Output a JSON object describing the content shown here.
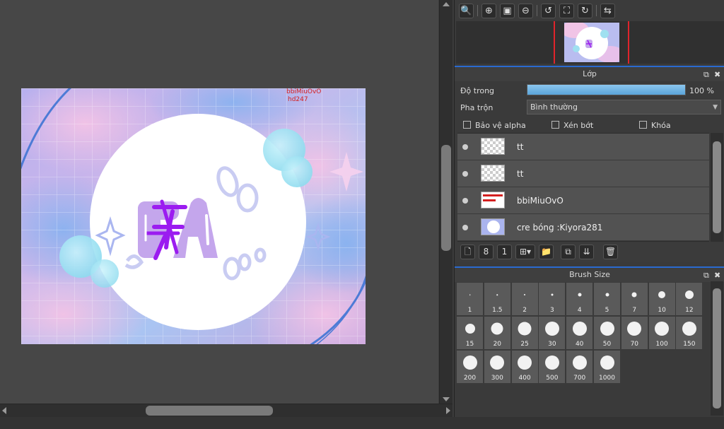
{
  "canvas": {
    "artwork_text_1": "bbiMiuOvO",
    "artwork_text_2": "hd247",
    "artwork_logo": "FA"
  },
  "navigator_toolbar": {
    "buttons": [
      {
        "icon": "magnifier-icon",
        "glyph": "🔍"
      },
      {
        "icon": "zoom-in-icon",
        "glyph": "⊕"
      },
      {
        "icon": "fit-window-icon",
        "glyph": "▣"
      },
      {
        "icon": "zoom-out-icon",
        "glyph": "⊖"
      },
      {
        "icon": "rotate-left-icon",
        "glyph": "↺"
      },
      {
        "icon": "reset-view-icon",
        "glyph": "⛶"
      },
      {
        "icon": "rotate-right-icon",
        "glyph": "↻"
      },
      {
        "icon": "flip-horizontal-icon",
        "glyph": "⇆"
      }
    ]
  },
  "layer_panel": {
    "title": "Lớp",
    "opacity_label": "Độ trong",
    "opacity_value": "100 %",
    "opacity_fraction": 1.0,
    "blend_label": "Pha trộn",
    "blend_value": "Bình thường",
    "checkboxes": [
      {
        "label": "Bảo vệ alpha",
        "checked": false
      },
      {
        "label": "Xén bớt",
        "checked": false
      },
      {
        "label": "Khóa",
        "checked": false
      }
    ],
    "layers": [
      {
        "name": "tt"
      },
      {
        "name": "tt"
      },
      {
        "name": "bbiMiuOvO"
      },
      {
        "name": "cre bóng :Kiyora281"
      }
    ],
    "tools": [
      {
        "icon": "new-layer-icon",
        "glyph": "🗋"
      },
      {
        "icon": "new-layer-8bit-icon",
        "glyph": "8"
      },
      {
        "icon": "new-layer-1bit-icon",
        "glyph": "1"
      },
      {
        "icon": "add-layer-menu-icon",
        "glyph": "⊞▾"
      },
      {
        "icon": "folder-icon",
        "glyph": "📁"
      },
      {
        "icon": "duplicate-layer-icon",
        "glyph": "⧉"
      },
      {
        "icon": "merge-layer-icon",
        "glyph": "⇊"
      },
      {
        "icon": "delete-layer-icon",
        "glyph": "🗑"
      }
    ]
  },
  "brush_panel": {
    "title": "Brush Size",
    "sizes": [
      "1",
      "1.5",
      "2",
      "3",
      "4",
      "5",
      "7",
      "10",
      "12",
      "15",
      "20",
      "25",
      "30",
      "40",
      "50",
      "70",
      "100",
      "150",
      "200",
      "300",
      "400",
      "500",
      "700",
      "1000"
    ]
  },
  "colors": {
    "accent_blue": "#2a6ad0",
    "opacity_fill": "#5aa4da",
    "logo_purple": "#9b1cf0",
    "logo_lavender": "#c4a6ec"
  }
}
